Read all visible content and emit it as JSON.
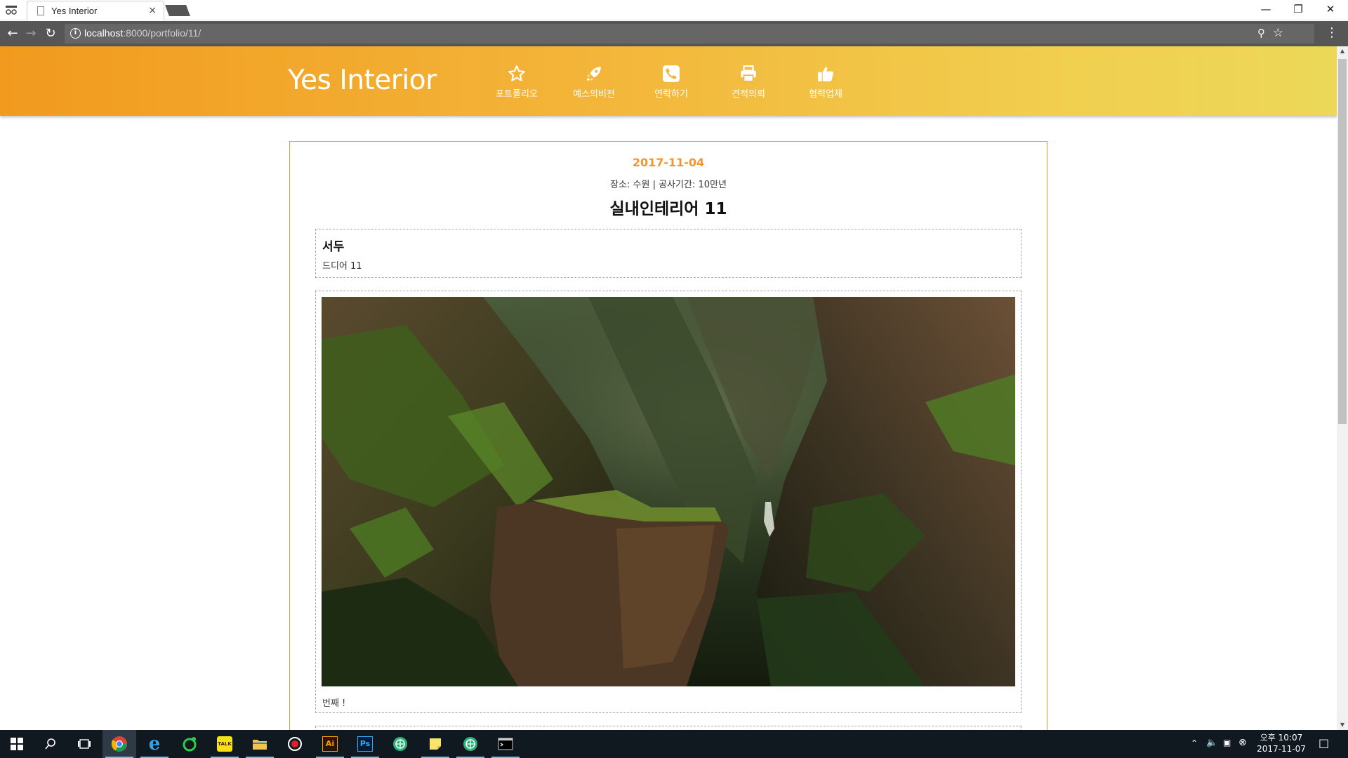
{
  "browser": {
    "tab_title": "Yes Interior",
    "tab_close": "×",
    "url_host": "localhost",
    "url_rest": ":8000/portfolio/11/",
    "window_controls": [
      "—",
      "❐",
      "✕"
    ]
  },
  "site": {
    "logo": "Yes Interior",
    "nav": [
      {
        "label": "포트폴리오",
        "icon": "star-icon"
      },
      {
        "label": "예스의비전",
        "icon": "rocket-icon"
      },
      {
        "label": "연락하기",
        "icon": "phone-icon"
      },
      {
        "label": "견적의뢰",
        "icon": "printer-icon"
      },
      {
        "label": "협력업체",
        "icon": "thumbs-up-icon"
      }
    ]
  },
  "post": {
    "date": "2017-11-04",
    "meta": "장소: 수원 | 공사기간: 10만년",
    "title": "실내인테리어 11",
    "intro_heading": "서두",
    "intro_text": "드디어 11",
    "photo_caption": "번째 !"
  },
  "taskbar": {
    "apps": [
      "windows-start-icon",
      "search-icon",
      "task-view-icon",
      "chrome-icon",
      "edge-icon",
      "line-icon",
      "kakaotalk-icon",
      "file-explorer-icon",
      "record-icon",
      "illustrator-icon",
      "photoshop-icon",
      "app-icon",
      "sticky-notes-icon",
      "app-icon",
      "terminal-icon"
    ],
    "kakao_label": "TALK",
    "ai_label": "Ai",
    "ps_label": "Ps",
    "clock_time": "오후 10:07",
    "clock_date": "2017-11-07"
  },
  "colors": {
    "header_start": "#f19a1e",
    "header_end": "#ecd858",
    "accent": "#f0962a"
  }
}
